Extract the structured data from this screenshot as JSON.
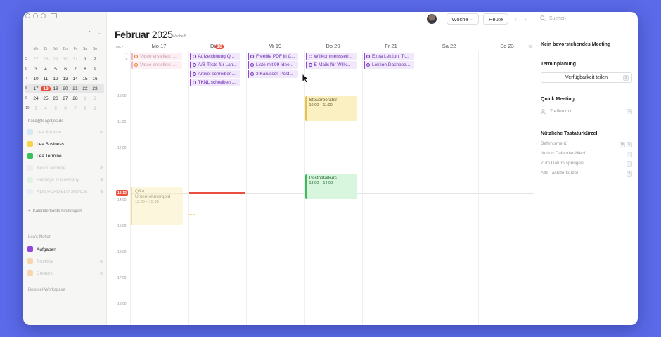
{
  "mini_calendar": {
    "weekday_headers": [
      "Mo",
      "Di",
      "Mi",
      "Do",
      "Fr",
      "Sa",
      "So"
    ],
    "weeks": [
      {
        "wk": "5",
        "days": [
          "27",
          "28",
          "29",
          "30",
          "31",
          "1",
          "2"
        ],
        "dim": [
          true,
          true,
          true,
          true,
          true,
          false,
          false
        ],
        "selected": false
      },
      {
        "wk": "6",
        "days": [
          "3",
          "4",
          "5",
          "6",
          "7",
          "8",
          "9"
        ],
        "dim": [
          false,
          false,
          false,
          false,
          false,
          false,
          false
        ],
        "selected": false
      },
      {
        "wk": "7",
        "days": [
          "10",
          "11",
          "12",
          "13",
          "14",
          "15",
          "16"
        ],
        "dim": [
          false,
          false,
          false,
          false,
          false,
          false,
          false
        ],
        "selected": false
      },
      {
        "wk": "8",
        "days": [
          "17",
          "18",
          "19",
          "20",
          "21",
          "22",
          "23"
        ],
        "dim": [
          false,
          false,
          false,
          false,
          false,
          false,
          false
        ],
        "selected": true
      },
      {
        "wk": "9",
        "days": [
          "24",
          "25",
          "26",
          "27",
          "28",
          "1",
          "2"
        ],
        "dim": [
          false,
          false,
          false,
          false,
          false,
          true,
          true
        ],
        "selected": false
      },
      {
        "wk": "10",
        "days": [
          "3",
          "4",
          "5",
          "6",
          "7",
          "8",
          "9"
        ],
        "dim": [
          true,
          true,
          true,
          true,
          true,
          true,
          true
        ],
        "selected": false
      }
    ],
    "today": "18",
    "nav_up": "⌃",
    "nav_down": "⌄"
  },
  "sidebar": {
    "account": "hallo@leagiltjes.de",
    "calendars": [
      {
        "label": "Lea & Kevin",
        "color": "#b9dcf7",
        "faded": true,
        "hidden": true
      },
      {
        "label": "Lea Business",
        "color": "#f6d44b",
        "faded": false,
        "hidden": false
      },
      {
        "label": "Lea Termine",
        "color": "#3fbf5b",
        "faded": false,
        "hidden": false
      },
      {
        "label": "Kevin Termine",
        "color": "#e3e3e3",
        "faded": true,
        "hidden": true
      },
      {
        "label": "Holidays in Germany",
        "color": "#cfe9d3",
        "faded": true,
        "hidden": true
      },
      {
        "label": "ADS FORMEL® 2024/25",
        "color": "#d7e5f5",
        "faded": true,
        "hidden": true
      }
    ],
    "add_account": "Kalenderkonto hinzufügen",
    "notion_title": "Lea's Notion",
    "notion_items": [
      {
        "label": "Aufgaben",
        "color": "#9146d9",
        "faded": false
      },
      {
        "label": "Projekte",
        "color": "#f7d6ae",
        "faded": true
      },
      {
        "label": "Content",
        "color": "#f7d6ae",
        "faded": true
      }
    ],
    "workspace": "Beispiel-Workspace"
  },
  "header": {
    "month": "Februar",
    "year": "2025",
    "week": "Woche 8",
    "view_button": "Woche",
    "today_button": "Heute",
    "timezone": "MEZ"
  },
  "days": [
    {
      "name": "Mo",
      "num": "17"
    },
    {
      "name": "Di",
      "num": "18",
      "today": true
    },
    {
      "name": "Mi",
      "num": "19"
    },
    {
      "name": "Do",
      "num": "20"
    },
    {
      "name": "Fr",
      "num": "21"
    },
    {
      "name": "Sa",
      "num": "22"
    },
    {
      "name": "So",
      "num": "23"
    }
  ],
  "all_day_events": [
    {
      "day": 0,
      "row": 0,
      "title": "Video erstellen: ...",
      "style": "orange"
    },
    {
      "day": 0,
      "row": 1,
      "title": "Video erstellen: ...",
      "style": "orange"
    },
    {
      "day": 1,
      "row": 0,
      "title": "Aufzeichnung Q...",
      "style": "purple"
    },
    {
      "day": 1,
      "row": 1,
      "title": "A/B-Tests für Lan...",
      "style": "purple"
    },
    {
      "day": 1,
      "row": 2,
      "title": "Artikel schreiben...",
      "style": "purple"
    },
    {
      "day": 1,
      "row": 3,
      "title": "TKNL schreiben ...",
      "style": "purple"
    },
    {
      "day": 2,
      "row": 0,
      "title": "Freebie PDF in C...",
      "style": "purple"
    },
    {
      "day": 2,
      "row": 1,
      "title": "Liste mit 99 Idee...",
      "style": "purple"
    },
    {
      "day": 2,
      "row": 2,
      "title": "3 Karussell-Post...",
      "style": "purple"
    },
    {
      "day": 3,
      "row": 0,
      "title": "Willkommensseri...",
      "style": "purple"
    },
    {
      "day": 3,
      "row": 1,
      "title": "E-Mails für Willk...",
      "style": "purple"
    },
    {
      "day": 4,
      "row": 0,
      "title": "Extra Lektion: Ti...",
      "style": "purple"
    },
    {
      "day": 4,
      "row": 1,
      "title": "Lektion Dashboa...",
      "style": "purple"
    }
  ],
  "hours": [
    "10:00",
    "11:00",
    "12:00",
    "13:00",
    "14:00",
    "15:00",
    "16:00",
    "17:00",
    "18:00"
  ],
  "now_time": "13:13",
  "events": [
    {
      "day": 3,
      "start": 10.0,
      "end": 11.0,
      "title": "Steuerberater",
      "time": "10:00 – 11:00",
      "style": "yel",
      "faded": false
    },
    {
      "day": 3,
      "start": 13.0,
      "end": 14.0,
      "title": "Postnatalkurs",
      "time": "13:00 – 14:00",
      "style": "grn",
      "faded": false
    },
    {
      "day": 0,
      "start": 13.5,
      "end": 15.0,
      "title": "Q&A Unternehmergold",
      "time": "13:30 – 15:00",
      "style": "yel",
      "faded": true
    }
  ],
  "right_panel": {
    "search_placeholder": "Suchen",
    "no_meeting": "Kein bevorstehendes Meeting",
    "scheduling_title": "Terminplanung",
    "share_button": "Verfügbarkeit teilen",
    "share_key": "S",
    "quick_title": "Quick Meeting",
    "quick_placeholder": "Treffen mit...",
    "quick_key": "F",
    "shortcuts_title": "Nützliche Tastaturkürzel",
    "shortcuts": [
      {
        "label": "Befehlsmenü",
        "keys": [
          "⌘",
          "K"
        ]
      },
      {
        "label": "Notion Calendar-Menü",
        "keys": [
          "'"
        ]
      },
      {
        "label": "Zum Datum springen",
        "keys": [
          "."
        ]
      },
      {
        "label": "Alle Tastaturkürzel",
        "keys": [
          "?"
        ]
      }
    ]
  }
}
